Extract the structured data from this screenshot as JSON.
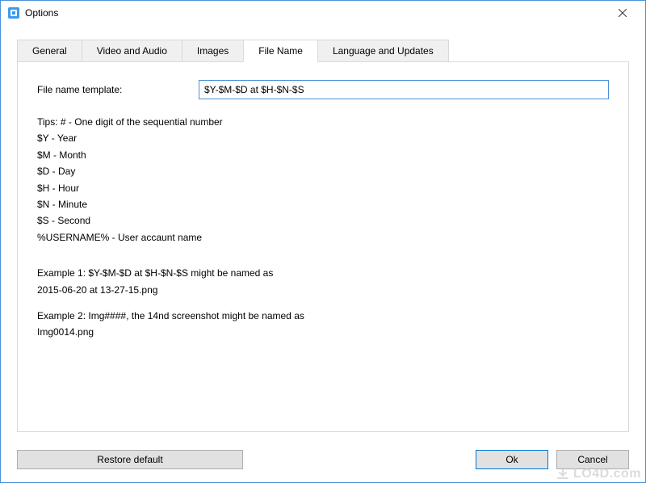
{
  "window": {
    "title": "Options"
  },
  "tabs": [
    {
      "label": "General"
    },
    {
      "label": "Video and Audio"
    },
    {
      "label": "Images"
    },
    {
      "label": "File Name"
    },
    {
      "label": "Language and Updates"
    }
  ],
  "filename": {
    "label": "File name template:",
    "value": "$Y-$M-$D at $H-$N-$S"
  },
  "tips": [
    "Tips: # - One digit of the sequential number",
    "$Y - Year",
    "$M - Month",
    "$D - Day",
    "$H - Hour",
    "$N - Minute",
    "$S - Second",
    "%USERNAME% - User accaunt name"
  ],
  "examples": [
    {
      "line1": "Example 1: $Y-$M-$D at $H-$N-$S might be named as",
      "line2": "2015-06-20 at 13-27-15.png"
    },
    {
      "line1": "Example 2: Img####, the 14nd screenshot might be named as",
      "line2": "Img0014.png"
    }
  ],
  "buttons": {
    "restore": "Restore default",
    "ok": "Ok",
    "cancel": "Cancel"
  },
  "watermark": "LO4D.com"
}
